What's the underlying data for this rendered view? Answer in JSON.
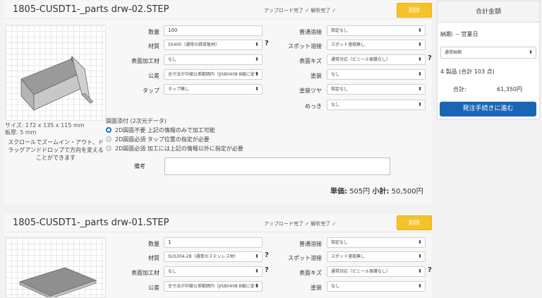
{
  "parts": [
    {
      "title": "1805-CUSDT1-_parts drw-02.STEP",
      "status": "アップロード完了 ✓ 解析完了 ✓",
      "delete_label": "削除",
      "labels": {
        "quantity": "数量",
        "material": "材質",
        "surface": "表面加工材",
        "tolerance": "公差",
        "tap": "タップ",
        "welding": "普通溶接",
        "spot": "スポット溶接",
        "scratch": "表面キズ",
        "paint": "塗装",
        "gloss": "塗装ツヤ",
        "plating": "めっき"
      },
      "values": {
        "quantity": "100",
        "material": "SS400（通常の鉄厚板材）",
        "surface": "なし",
        "tolerance": "全寸法が中級公差範囲内（JISB0408 B級に従う",
        "tap": "タップ無し",
        "welding": "指定なし",
        "spot": "スポット溶接無し",
        "scratch": "通常対応（ビニール保護なし）",
        "paint": "なし",
        "gloss": "指定なし",
        "plating": "なし"
      },
      "size": "サイズ: 172 x 135 x 115 mm",
      "thickness": "板厚: 5 mm",
      "tip": [
        "スクロールでズームイン・アウト、ド",
        "ラッグアンドドロップで方向を変える",
        "ことができます"
      ],
      "drawing_title": "図面添付 (2次元データ)",
      "drawing_options": [
        "2D図面不要 上記の情報のみで加工可能",
        "2D図面必須 タップ位置の指定が必要",
        "2D図面必須 加工には上記の情報以外に指定が必要"
      ],
      "memo_label": "備考",
      "unit_price_label": "単価:",
      "unit_price": "505円",
      "subtotal_label": "小計:",
      "subtotal": "50,500円"
    },
    {
      "title": "1805-CUSDT1-_parts drw-01.STEP",
      "status": "アップロード完了 ✓ 解析完了 ✓",
      "delete_label": "削除",
      "labels": {
        "quantity": "数量",
        "material": "材質",
        "surface": "表面加工材",
        "tolerance": "公差",
        "welding": "普通溶接",
        "spot": "スポット溶接",
        "scratch": "表面キズ",
        "paint": "塗装"
      },
      "values": {
        "quantity": "1",
        "material": "SUS304-2B（通常のステンレス材）",
        "surface": "なし",
        "tolerance": "全寸法が中級公差範囲内（JISB0408 B級に従う",
        "welding": "指定なし",
        "spot": "スポット溶接無し",
        "scratch": "通常対応（ビニール保護なし）",
        "paint": "なし"
      }
    }
  ],
  "summary": {
    "title": "合計金額",
    "delivery": "納期: -- 営業日",
    "delivery_select": "通常納期",
    "count": "4 製品 (合計 103 点)",
    "total_label": "合計:",
    "total": "61,350円",
    "order_label": "発注手続きに進む"
  },
  "help_mark": "?",
  "arrow": "⬍"
}
